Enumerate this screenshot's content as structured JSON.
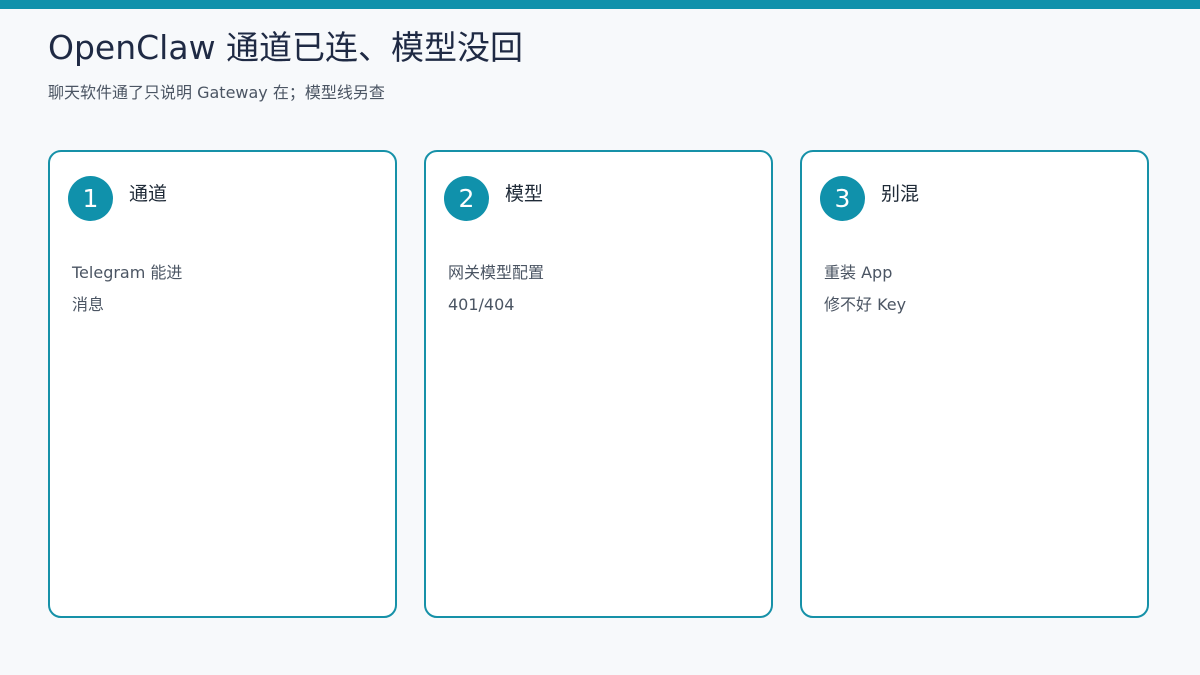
{
  "theme": {
    "accent": "#1091ab"
  },
  "slide": {
    "title": "OpenClaw 通道已连、模型没回",
    "subtitle": "聊天软件通了只说明 Gateway 在；模型线另查"
  },
  "cards": [
    {
      "number": "1",
      "title": "通道",
      "lines": [
        "Telegram 能进",
        "消息"
      ]
    },
    {
      "number": "2",
      "title": "模型",
      "lines": [
        "网关模型配置",
        "401/404"
      ]
    },
    {
      "number": "3",
      "title": "别混",
      "lines": [
        "重装 App",
        "修不好 Key"
      ]
    }
  ]
}
